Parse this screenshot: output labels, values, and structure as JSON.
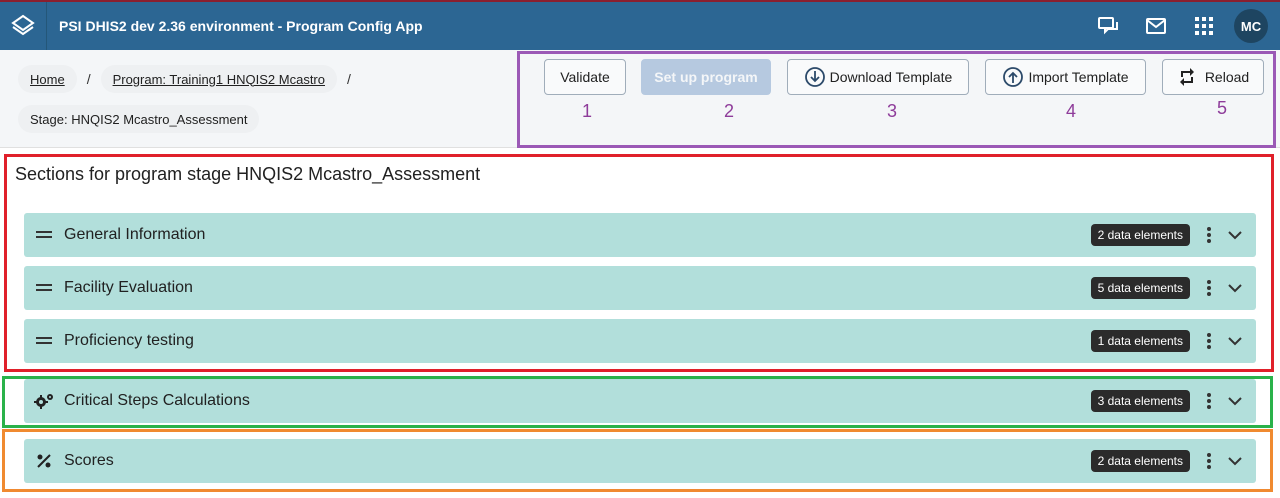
{
  "header": {
    "app_title": "PSI DHIS2 dev 2.36 environment - Program Config App",
    "logo_icon": "dhis2-logo-icon",
    "icons": [
      "interpretations-icon",
      "messages-icon",
      "apps-grid-icon"
    ],
    "avatar": "MC",
    "color": "#2c6693"
  },
  "breadcrumb": {
    "home": "Home",
    "program": "Program: Training1 HNQIS2 Mcastro",
    "separator": "/",
    "stage": "Stage: HNQIS2 Mcastro_Assessment"
  },
  "toolbar": {
    "validate": "Validate",
    "setup": "Set up program",
    "download": "Download Template",
    "import": "Import Template",
    "reload": "Reload",
    "annotations": [
      "1",
      "2",
      "3",
      "4",
      "5"
    ]
  },
  "main": {
    "title": "Sections for program stage HNQIS2 Mcastro_Assessment",
    "sections": [
      {
        "name": "General Information",
        "badge": "2 data elements",
        "icon": "drag-handle-icon"
      },
      {
        "name": "Facility Evaluation",
        "badge": "5 data elements",
        "icon": "drag-handle-icon"
      },
      {
        "name": "Proficiency testing",
        "badge": "1 data elements",
        "icon": "drag-handle-icon"
      },
      {
        "name": "Critical Steps Calculations",
        "badge": "3 data elements",
        "icon": "gears-icon"
      },
      {
        "name": "Scores",
        "badge": "2 data elements",
        "icon": "percent-icon"
      }
    ]
  },
  "colors": {
    "row_bg": "#b2dfdb",
    "annotation_purple": "#9b59b6",
    "annotation_red": "#e0202a",
    "annotation_green": "#2ab24a",
    "annotation_orange": "#f08a30"
  }
}
